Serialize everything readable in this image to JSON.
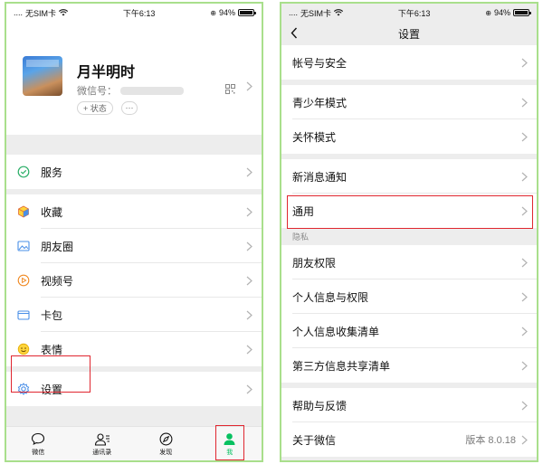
{
  "status_bar": {
    "signal": "....",
    "carrier": "无SIM卡",
    "time": "下午6:13",
    "battery_text": "94%",
    "battery_level": 0.94
  },
  "me_page": {
    "nickname": "月半明时",
    "wechat_id_label": "微信号：",
    "status_button": "+ 状态",
    "more_button": "···",
    "menu": [
      {
        "label": "服务",
        "icon": "service-icon"
      },
      {
        "label": "收藏",
        "icon": "favorites-icon"
      },
      {
        "label": "朋友圈",
        "icon": "moments-icon"
      },
      {
        "label": "视频号",
        "icon": "channels-icon"
      },
      {
        "label": "卡包",
        "icon": "card-wallet-icon"
      },
      {
        "label": "表情",
        "icon": "stickers-icon"
      },
      {
        "label": "设置",
        "icon": "gear-icon"
      }
    ],
    "tabbar": [
      {
        "label": "微信",
        "icon": "chat-bubble-icon",
        "active": false
      },
      {
        "label": "通讯录",
        "icon": "contacts-icon",
        "active": false
      },
      {
        "label": "发现",
        "icon": "compass-icon",
        "active": false
      },
      {
        "label": "我",
        "icon": "person-icon",
        "active": true
      }
    ]
  },
  "settings_page": {
    "title": "设置",
    "items": [
      {
        "label": "帐号与安全"
      },
      {
        "label": "青少年模式"
      },
      {
        "label": "关怀模式"
      },
      {
        "label": "新消息通知"
      },
      {
        "label": "通用"
      },
      {
        "label": "朋友权限"
      },
      {
        "label": "个人信息与权限"
      },
      {
        "label": "个人信息收集清单"
      },
      {
        "label": "第三方信息共享清单"
      },
      {
        "label": "帮助与反馈"
      },
      {
        "label": "关于微信",
        "value": "版本 8.0.18"
      }
    ],
    "privacy_section_label": "隐私"
  },
  "colors": {
    "wechat_green": "#07c160",
    "highlight_red": "#e0262f",
    "frame_green": "#a9df8c",
    "background_gray": "#ededed"
  }
}
